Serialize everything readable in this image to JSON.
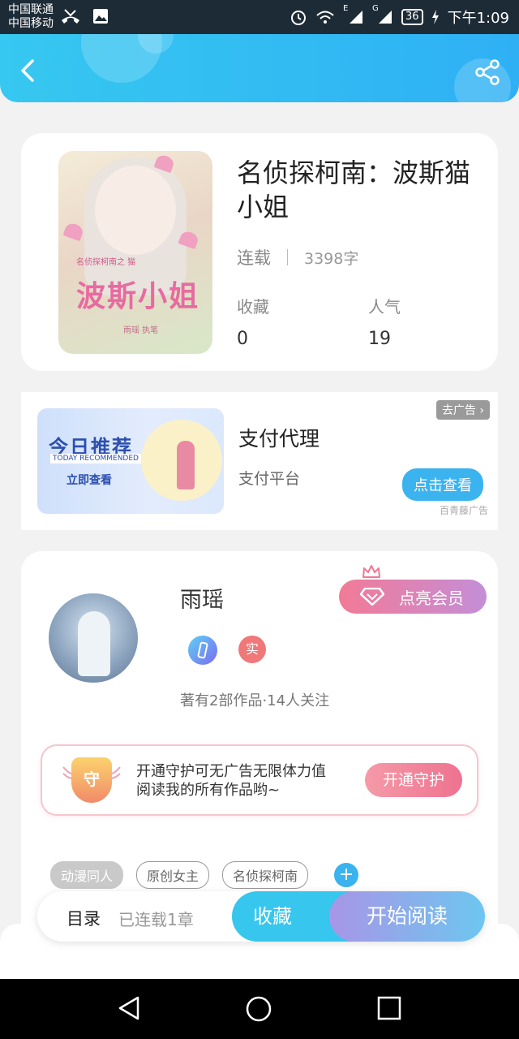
{
  "status_bar": {
    "carrier_1": "中国联通",
    "carrier_2": "中国移动",
    "battery": "36",
    "time": "下午1:09",
    "net_1": "E",
    "net_2": "G"
  },
  "header": {
    "back_icon": "chevron-left-icon",
    "share_icon": "share-icon"
  },
  "book": {
    "title": "名侦探柯南：波斯猫小姐",
    "cover_text": "波斯小姐",
    "cover_small_text": "名侦探柯南之 猫",
    "cover_author_text": "雨瑶 执笔",
    "status": "连载",
    "word_count": "3398字",
    "favorites_label": "收藏",
    "favorites_value": "0",
    "popularity_label": "人气",
    "popularity_value": "19"
  },
  "ad": {
    "image_title": "今日推荐",
    "image_subtitle": "TODAY RECOMMENDED",
    "image_cta": "立即查看",
    "title": "支付代理",
    "subtitle": "支付平台",
    "close_label": "去广告 ›",
    "button_label": "点击查看",
    "source": "百青藤广告"
  },
  "author": {
    "name": "雨瑶",
    "vip_button": "点亮会员",
    "badge_real": "实",
    "stats": "著有2部作品·14人关注",
    "guard_shield": "守",
    "guard_text": "开通守护可无广告无限体力值阅读我的所有作品哟~",
    "guard_button": "开通守护",
    "tags": [
      "动漫同人",
      "原创女主",
      "名侦探柯南"
    ],
    "tag_add": "+"
  },
  "action_bar": {
    "toc": "目录",
    "progress": "已连载1章",
    "favorite": "收藏",
    "start_reading": "开始阅读"
  },
  "colors": {
    "header_start": "#36c8f0",
    "header_end": "#2fb0f5",
    "accent_blue": "#3ab3ef",
    "vip_pink": "#f27a96",
    "vip_purple": "#c48ed8"
  }
}
